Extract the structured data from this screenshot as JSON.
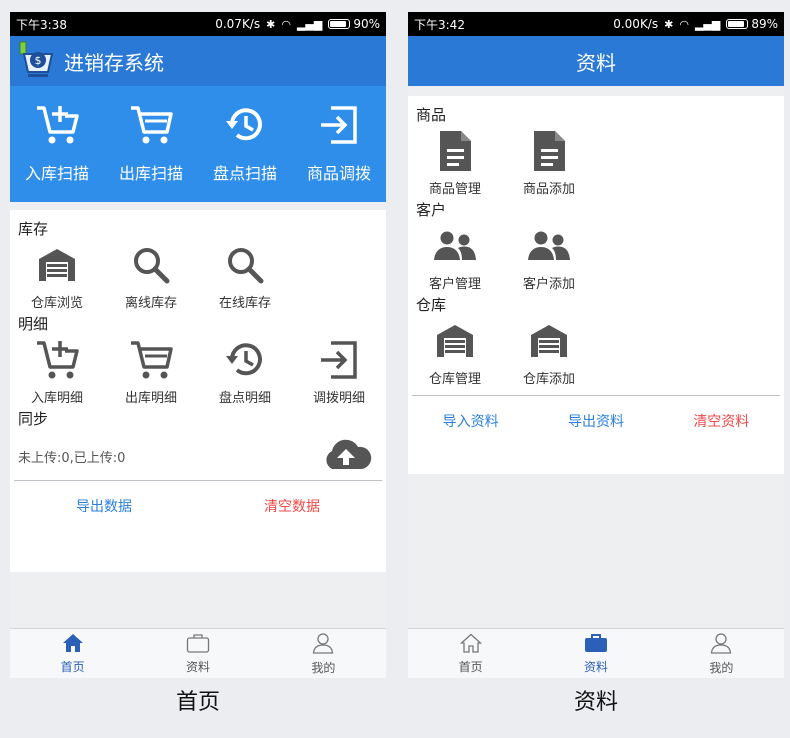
{
  "left": {
    "status": {
      "time": "下午3:38",
      "speed": "0.07K/s",
      "battery": "90%",
      "battery_level": 0.9
    },
    "title": "进销存系统",
    "scan_actions": [
      {
        "label": "入库扫描",
        "icon": "cart-plus-icon"
      },
      {
        "label": "出库扫描",
        "icon": "cart-out-icon"
      },
      {
        "label": "盘点扫描",
        "icon": "history-icon"
      },
      {
        "label": "商品调拨",
        "icon": "transfer-icon"
      }
    ],
    "inventory": {
      "title": "库存",
      "items": [
        {
          "label": "仓库浏览",
          "icon": "warehouse-icon"
        },
        {
          "label": "离线库存",
          "icon": "search-icon"
        },
        {
          "label": "在线库存",
          "icon": "search-icon"
        }
      ]
    },
    "details": {
      "title": "明细",
      "items": [
        {
          "label": "入库明细",
          "icon": "cart-plus-icon"
        },
        {
          "label": "出库明细",
          "icon": "cart-out-icon"
        },
        {
          "label": "盘点明细",
          "icon": "history-icon"
        },
        {
          "label": "调拨明细",
          "icon": "transfer-icon"
        }
      ]
    },
    "sync": {
      "title": "同步",
      "status": "未上传:0,已上传:0"
    },
    "actions": {
      "export": "导出数据",
      "clear": "清空数据"
    },
    "tabs": [
      {
        "label": "首页",
        "icon": "home-icon",
        "active": true
      },
      {
        "label": "资料",
        "icon": "briefcase-icon",
        "active": false
      },
      {
        "label": "我的",
        "icon": "user-icon",
        "active": false
      }
    ],
    "caption": "首页"
  },
  "right": {
    "status": {
      "time": "下午3:42",
      "speed": "0.00K/s",
      "battery": "89%",
      "battery_level": 0.89
    },
    "title": "资料",
    "goods": {
      "title": "商品",
      "items": [
        {
          "label": "商品管理",
          "icon": "document-icon"
        },
        {
          "label": "商品添加",
          "icon": "document-icon"
        }
      ]
    },
    "customers": {
      "title": "客户",
      "items": [
        {
          "label": "客户管理",
          "icon": "people-icon"
        },
        {
          "label": "客户添加",
          "icon": "people-icon"
        }
      ]
    },
    "warehouse": {
      "title": "仓库",
      "items": [
        {
          "label": "仓库管理",
          "icon": "warehouse-icon"
        },
        {
          "label": "仓库添加",
          "icon": "warehouse-icon"
        }
      ]
    },
    "actions": {
      "import": "导入资料",
      "export": "导出资料",
      "clear": "清空资料"
    },
    "tabs": [
      {
        "label": "首页",
        "icon": "home-icon",
        "active": false
      },
      {
        "label": "资料",
        "icon": "briefcase-icon",
        "active": true
      },
      {
        "label": "我的",
        "icon": "user-icon",
        "active": false
      }
    ],
    "caption": "资料"
  },
  "colors": {
    "appbar": "#2b79d6",
    "scanbar": "#2f8eea",
    "active_tab": "#2c5fb8",
    "link_blue": "#2b7fd8",
    "danger_red": "#ee4a4a",
    "icon_gray": "#555555"
  }
}
